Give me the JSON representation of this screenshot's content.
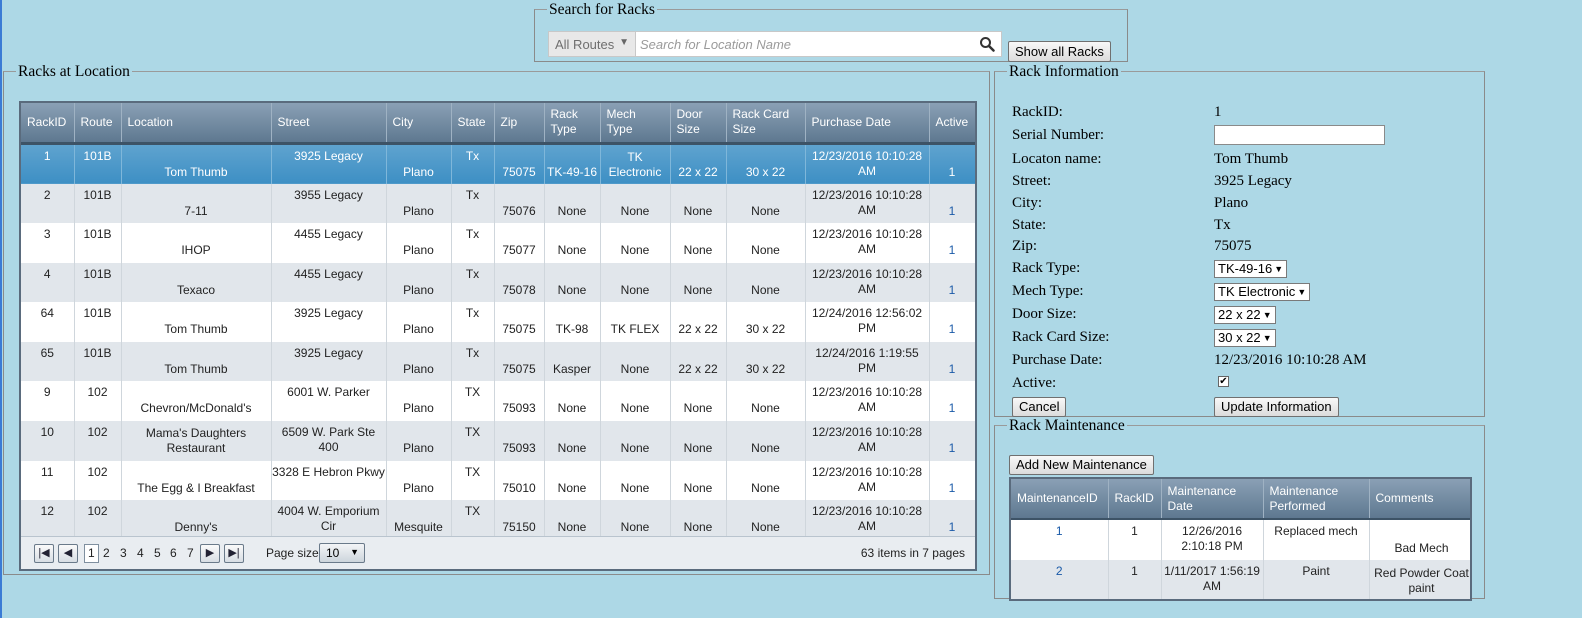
{
  "search": {
    "legend": "Search for Racks",
    "route_selected": "All Routes",
    "placeholder": "Search for Location Name",
    "show_all_label": "Show all Racks"
  },
  "racks": {
    "legend": "Racks at Location",
    "columns": [
      "RackID",
      "Route",
      "Location",
      "Street",
      "City",
      "State",
      "Zip",
      "Rack Type",
      "Mech Type",
      "Door Size",
      "Rack Card Size",
      "Purchase Date",
      "Active"
    ],
    "rows": [
      {
        "id": "1",
        "route": "101B",
        "location": "Tom Thumb",
        "street": "3925 Legacy",
        "city": "Plano",
        "state": "Tx",
        "zip": "75075",
        "rack_type": "TK-49-16",
        "mech_type": "TK Electronic",
        "door": "22 x 22",
        "card": "30 x 22",
        "date": "12/23/2016 10:10:28 AM",
        "active": "1"
      },
      {
        "id": "2",
        "route": "101B",
        "location": "7-11",
        "street": "3955 Legacy",
        "city": "Plano",
        "state": "Tx",
        "zip": "75076",
        "rack_type": "None",
        "mech_type": "None",
        "door": "None",
        "card": "None",
        "date": "12/23/2016 10:10:28 AM",
        "active": "1"
      },
      {
        "id": "3",
        "route": "101B",
        "location": "IHOP",
        "street": "4455 Legacy",
        "city": "Plano",
        "state": "Tx",
        "zip": "75077",
        "rack_type": "None",
        "mech_type": "None",
        "door": "None",
        "card": "None",
        "date": "12/23/2016 10:10:28 AM",
        "active": "1"
      },
      {
        "id": "4",
        "route": "101B",
        "location": "Texaco",
        "street": "4455 Legacy",
        "city": "Plano",
        "state": "Tx",
        "zip": "75078",
        "rack_type": "None",
        "mech_type": "None",
        "door": "None",
        "card": "None",
        "date": "12/23/2016 10:10:28 AM",
        "active": "1"
      },
      {
        "id": "64",
        "route": "101B",
        "location": "Tom Thumb",
        "street": "3925 Legacy",
        "city": "Plano",
        "state": "Tx",
        "zip": "75075",
        "rack_type": "TK-98",
        "mech_type": "TK FLEX",
        "door": "22 x 22",
        "card": "30 x 22",
        "date": "12/24/2016 12:56:02 PM",
        "active": "1"
      },
      {
        "id": "65",
        "route": "101B",
        "location": "Tom Thumb",
        "street": "3925 Legacy",
        "city": "Plano",
        "state": "Tx",
        "zip": "75075",
        "rack_type": "Kasper",
        "mech_type": "None",
        "door": "22 x 22",
        "card": "30 x 22",
        "date": "12/24/2016 1:19:55 PM",
        "active": "1"
      },
      {
        "id": "9",
        "route": "102",
        "location": "Chevron/McDonald's",
        "street": "6001 W. Parker",
        "city": "Plano",
        "state": "TX",
        "zip": "75093",
        "rack_type": "None",
        "mech_type": "None",
        "door": "None",
        "card": "None",
        "date": "12/23/2016 10:10:28 AM",
        "active": "1"
      },
      {
        "id": "10",
        "route": "102",
        "location": "Mama's Daughters Restaurant",
        "street": "6509 W. Park Ste 400",
        "city": "Plano",
        "state": "TX",
        "zip": "75093",
        "rack_type": "None",
        "mech_type": "None",
        "door": "None",
        "card": "None",
        "date": "12/23/2016 10:10:28 AM",
        "active": "1"
      },
      {
        "id": "11",
        "route": "102",
        "location": "The Egg & I Breakfast",
        "street": "3328 E Hebron Pkwy",
        "city": "Plano",
        "state": "TX",
        "zip": "75010",
        "rack_type": "None",
        "mech_type": "None",
        "door": "None",
        "card": "None",
        "date": "12/23/2016 10:10:28 AM",
        "active": "1"
      },
      {
        "id": "12",
        "route": "102",
        "location": "Denny's",
        "street": "4004 W. Emporium Cir",
        "city": "Mesquite",
        "state": "TX",
        "zip": "75150",
        "rack_type": "None",
        "mech_type": "None",
        "door": "None",
        "card": "None",
        "date": "12/23/2016 10:10:28 AM",
        "active": "1"
      }
    ],
    "pager": {
      "first": "⏮",
      "prev": "◀",
      "next": "▶",
      "last": "⏭",
      "pages": [
        "1",
        "2",
        "3",
        "4",
        "5",
        "6",
        "7"
      ],
      "page_size_label": "Page size:",
      "page_size": "10",
      "items_count": "63",
      "items_in": "items in",
      "pages_count": "7",
      "pages_word": "pages"
    }
  },
  "info": {
    "legend": "Rack Information",
    "labels": {
      "rackid": "RackID:",
      "serial": "Serial Number:",
      "location": "Locaton name:",
      "street": "Street:",
      "city": "City:",
      "state": "State:",
      "zip": "Zip:",
      "rack_type": "Rack Type:",
      "mech_type": "Mech Type:",
      "door": "Door Size:",
      "card": "Rack Card Size:",
      "date": "Purchase Date:",
      "active": "Active:"
    },
    "values": {
      "rackid": "1",
      "serial": "",
      "location": "Tom Thumb",
      "street": "3925 Legacy",
      "city": "Plano",
      "state": "Tx",
      "zip": "75075",
      "rack_type": "TK-49-16",
      "mech_type": "TK Electronic",
      "door": "22 x 22",
      "card": "30 x 22",
      "date": "12/23/2016 10:10:28 AM",
      "active_check": "✔"
    },
    "cancel_label": "Cancel",
    "update_label": "Update Information"
  },
  "maintenance": {
    "legend": "Rack Maintenance",
    "add_label": "Add New Maintenance",
    "columns": [
      "MaintenanceID",
      "RackID",
      "Maintenance Date",
      "Maintenance Performed",
      "Comments"
    ],
    "rows": [
      {
        "id": "1",
        "rackid": "1",
        "date": "12/26/2016 2:10:18 PM",
        "performed": "Replaced mech",
        "comments": "Bad Mech"
      },
      {
        "id": "2",
        "rackid": "1",
        "date": "1/11/2017 1:56:19 AM",
        "performed": "Paint",
        "comments": "Red Powder Coat paint"
      }
    ]
  },
  "colors": {
    "background": "#add8e6",
    "header": "#5e7890",
    "selected_row": "#4a98ca",
    "alt_row": "#e1e6eb"
  }
}
